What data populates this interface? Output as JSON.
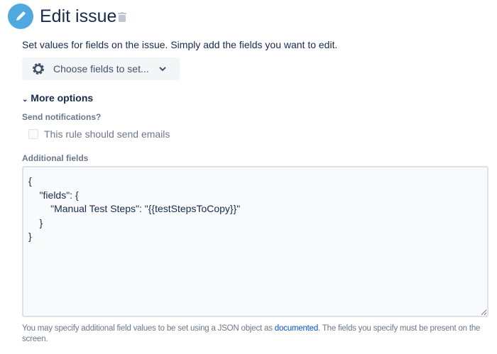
{
  "header": {
    "title": "Edit issue",
    "icon": "pencil-icon",
    "delete_icon": "trash-icon"
  },
  "description": "Set values for fields on the issue. Simply add the fields you want to edit.",
  "choose_fields": {
    "label": "Choose fields to set...",
    "icon": "gear-icon"
  },
  "more_options": {
    "label": "More options"
  },
  "notifications": {
    "label": "Send notifications?",
    "checkbox_label": "This rule should send emails",
    "checked": false
  },
  "additional_fields": {
    "label": "Additional fields",
    "value": "{\n    \"fields\": {\n        \"Manual Test Steps\": \"{{testStepsToCopy}}\"\n    }\n}"
  },
  "help": {
    "before": "You may specify additional field values to be set using a JSON object as ",
    "link": "documented",
    "after": ". The fields you specify must be present on the screen."
  },
  "colors": {
    "accent": "#4fa8e0",
    "link": "#0052cc"
  }
}
